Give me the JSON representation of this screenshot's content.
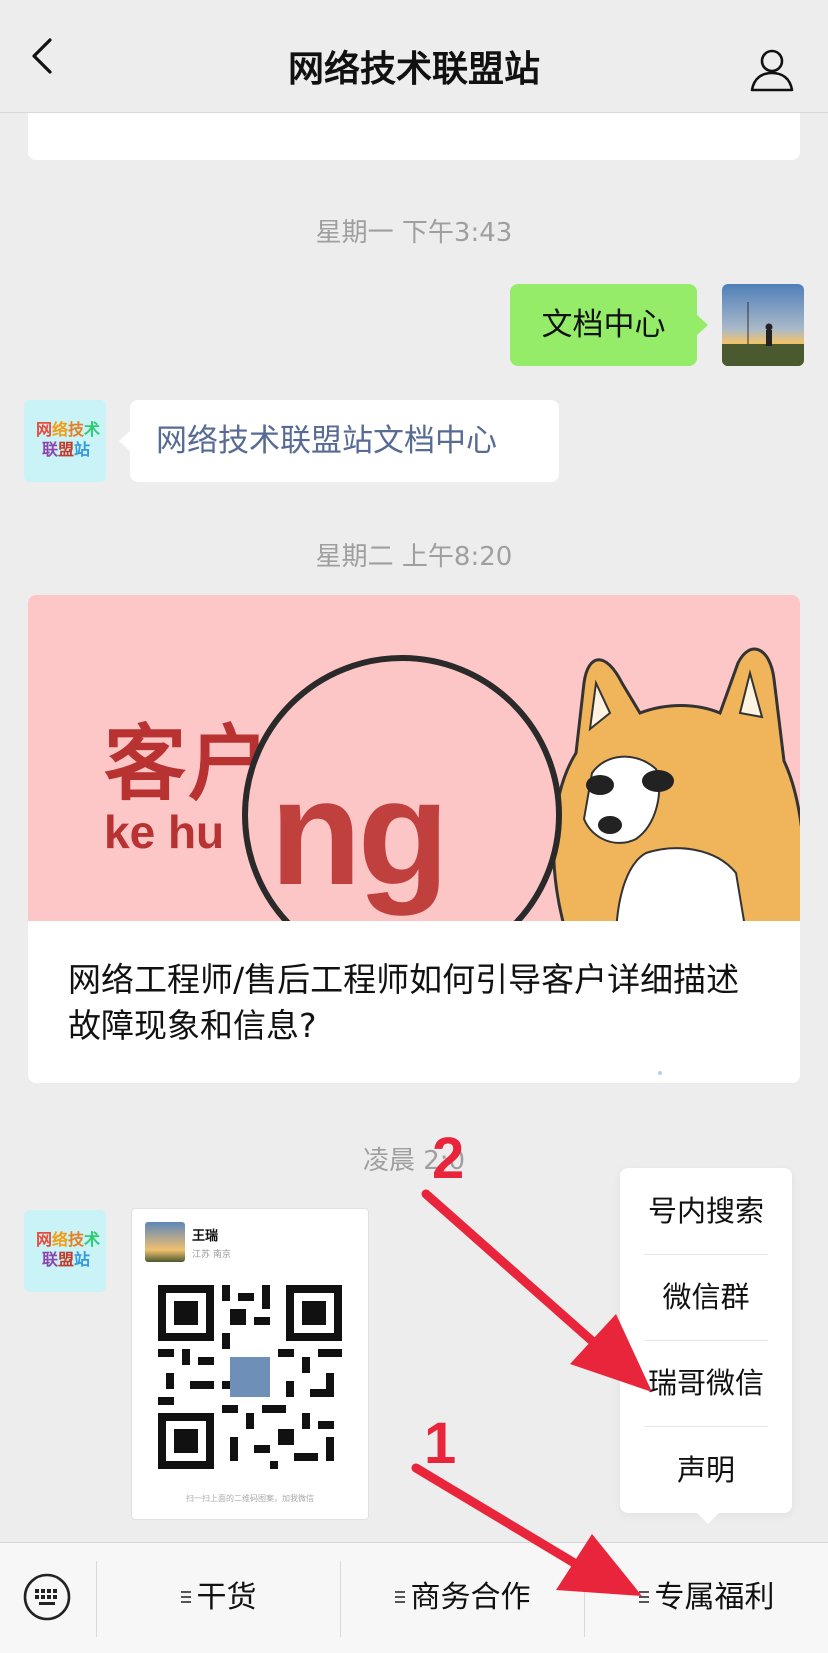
{
  "nav": {
    "title": "网络技术联盟站"
  },
  "timestamps": [
    "星期一 下午3:43",
    "星期二 上午8:20",
    "凌晨 2:0"
  ],
  "messages": {
    "sent_text": "文档中心",
    "reply_link_text": "网络技术联盟站文档中心",
    "bot_avatar_text": [
      "网",
      "络",
      "技",
      "术",
      "联",
      "盟",
      "站"
    ]
  },
  "article": {
    "cover_text_cn": "客户",
    "cover_text_pinyin": "ke hu",
    "cover_zoom_text": "ng",
    "title": "网络工程师/售后工程师如何引导客户详细描述故障现象和信息?"
  },
  "qr_card": {
    "name": "王瑞",
    "location": "江苏 南京",
    "caption": "扫一扫上面的二维码图案，加我微信"
  },
  "popup_menu": {
    "items": [
      "号内搜索",
      "微信群",
      "瑞哥微信",
      "声明"
    ]
  },
  "bottom_tabs": [
    "干货",
    "商务合作",
    "专属福利"
  ],
  "annotations": [
    "2",
    "1"
  ],
  "colors": {
    "sent_bubble": "#95ec69",
    "link_text": "#576b95",
    "annotation": "#e8253a",
    "background": "#ededed"
  }
}
